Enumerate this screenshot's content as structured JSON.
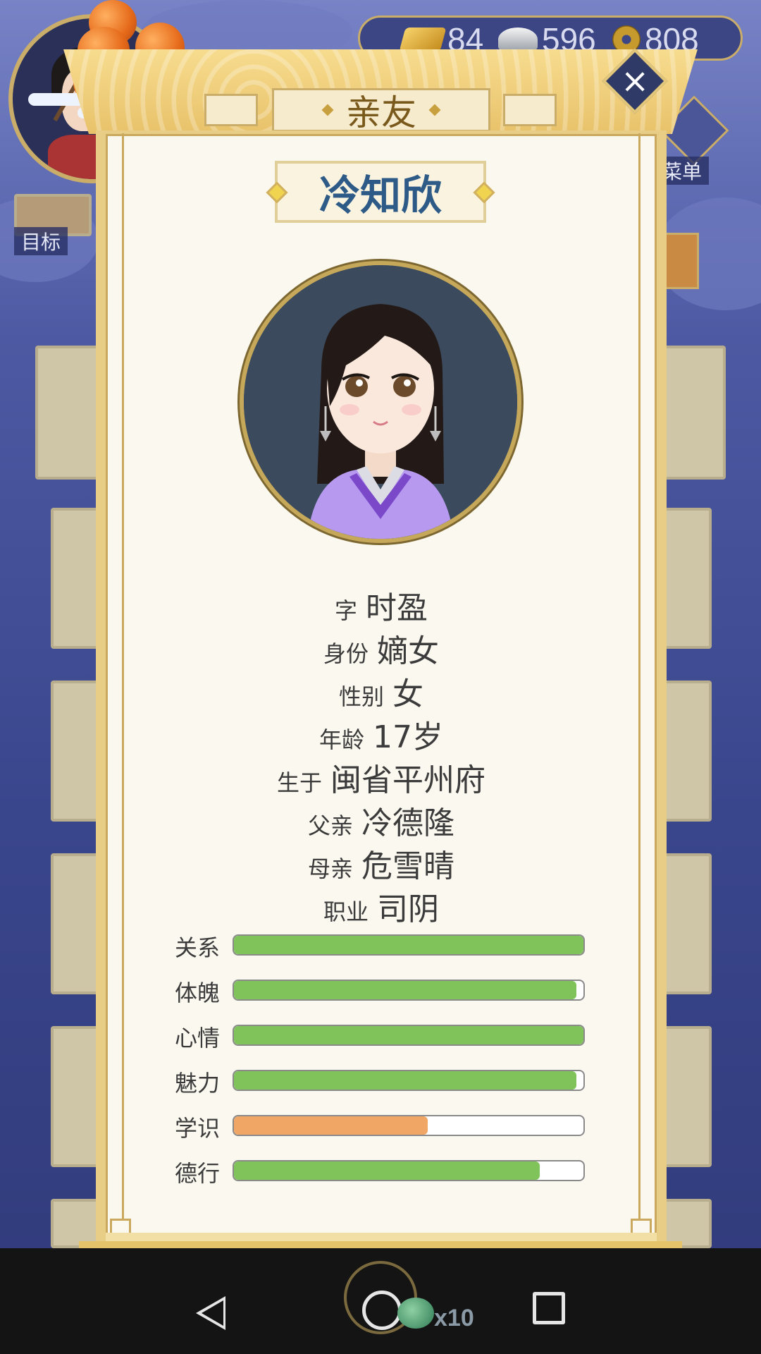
{
  "hud": {
    "currency": {
      "gold": "84",
      "silver": "596",
      "copper": "808"
    },
    "side_labels": {
      "goal": "目标",
      "menu": "菜单"
    }
  },
  "dialog": {
    "title": "亲友",
    "close_label": "×",
    "name": "冷知欣",
    "info": [
      {
        "key": "字",
        "value": "时盈"
      },
      {
        "key": "身份",
        "value": "嫡女"
      },
      {
        "key": "性别",
        "value": "女"
      },
      {
        "key": "年龄",
        "value": "17岁"
      },
      {
        "key": "生于",
        "value": "闽省平州府"
      },
      {
        "key": "父亲",
        "value": "冷德隆"
      },
      {
        "key": "母亲",
        "value": "危雪晴"
      },
      {
        "key": "职业",
        "value": "司阴"
      }
    ],
    "stats": [
      {
        "label": "关系",
        "value": 1.0,
        "color": "#7fc35a"
      },
      {
        "label": "体魄",
        "value": 0.98,
        "color": "#7fc35a"
      },
      {
        "label": "心情",
        "value": 1.0,
        "color": "#7fc35a"
      },
      {
        "label": "魅力",
        "value": 0.98,
        "color": "#7fc35a"
      },
      {
        "label": "学识",
        "value": 0.555,
        "color": "#f0a766"
      },
      {
        "label": "德行",
        "value": 0.875,
        "color": "#7fc35a"
      }
    ]
  },
  "bottom": {
    "reward_count": "x10"
  },
  "colors": {
    "name_blue": "#2d5a86",
    "frame_gold": "#c9ad69",
    "panel_bg": "#fbf8ef"
  }
}
